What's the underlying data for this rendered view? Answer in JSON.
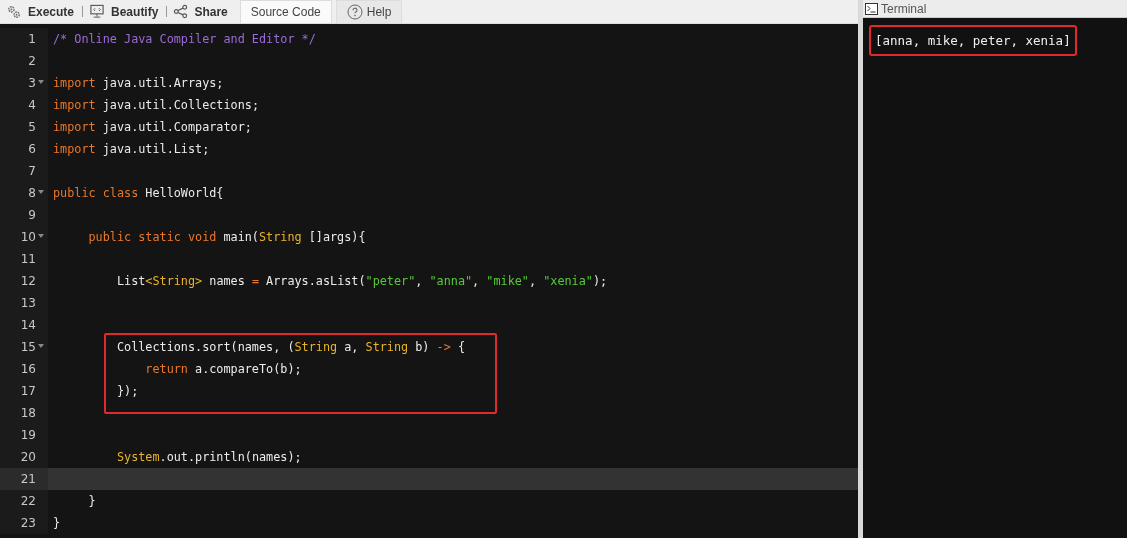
{
  "toolbar": [
    {
      "kind": "action",
      "label": "Execute"
    },
    {
      "kind": "action",
      "label": "Beautify"
    },
    {
      "kind": "action",
      "label": "Share"
    },
    {
      "kind": "tab",
      "label": "Source Code",
      "selected": true
    },
    {
      "kind": "tab",
      "label": "Help",
      "selected": false
    }
  ],
  "editor": {
    "lines": [
      {
        "number": "1",
        "tokens": [
          {
            "kind": "comment",
            "text": "/* Online Java Compiler and Editor */"
          }
        ]
      },
      {
        "number": "2"
      },
      {
        "number": "3",
        "foldable": true,
        "tokens": [
          {
            "kind": "keyword",
            "text": "import"
          },
          {
            "kind": "plain",
            "text": " java.util.Arrays;"
          }
        ]
      },
      {
        "number": "4",
        "tokens": [
          {
            "kind": "keyword",
            "text": "import"
          },
          {
            "kind": "plain",
            "text": " java.util.Collections;"
          }
        ]
      },
      {
        "number": "5",
        "tokens": [
          {
            "kind": "keyword",
            "text": "import"
          },
          {
            "kind": "plain",
            "text": " java.util.Comparator;"
          }
        ]
      },
      {
        "number": "6",
        "tokens": [
          {
            "kind": "keyword",
            "text": "import"
          },
          {
            "kind": "plain",
            "text": " java.util.List;"
          }
        ]
      },
      {
        "number": "7"
      },
      {
        "number": "8",
        "foldable": true,
        "tokens": [
          {
            "kind": "keyword",
            "text": "public class"
          },
          {
            "kind": "plain",
            "text": " HelloWorld{"
          }
        ]
      },
      {
        "number": "9"
      },
      {
        "number": "10",
        "foldable": true,
        "tokens": [
          {
            "kind": "keyword",
            "text": "     public static void"
          },
          {
            "kind": "plain",
            "text": " main("
          },
          {
            "kind": "type",
            "text": "String"
          },
          {
            "kind": "plain",
            "text": " []args){"
          }
        ]
      },
      {
        "number": "11"
      },
      {
        "number": "12",
        "tokens": [
          {
            "kind": "plain",
            "text": "         List"
          },
          {
            "kind": "type",
            "text": "<String>"
          },
          {
            "kind": "plain",
            "text": " names "
          },
          {
            "kind": "keyword",
            "text": "="
          },
          {
            "kind": "plain",
            "text": " Arrays.asList("
          },
          {
            "kind": "string",
            "text": "\"peter\""
          },
          {
            "kind": "plain",
            "text": ", "
          },
          {
            "kind": "string",
            "text": "\"anna\""
          },
          {
            "kind": "plain",
            "text": ", "
          },
          {
            "kind": "string",
            "text": "\"mike\""
          },
          {
            "kind": "plain",
            "text": ", "
          },
          {
            "kind": "string",
            "text": "\"xenia\""
          },
          {
            "kind": "plain",
            "text": ");"
          }
        ]
      },
      {
        "number": "13"
      },
      {
        "number": "14"
      },
      {
        "number": "15",
        "foldable": true,
        "boxed": true,
        "tokens": [
          {
            "kind": "plain",
            "text": "         Collections.sort(names, ("
          },
          {
            "kind": "type",
            "text": "String"
          },
          {
            "kind": "plain",
            "text": " a, "
          },
          {
            "kind": "type",
            "text": "String"
          },
          {
            "kind": "plain",
            "text": " b) "
          },
          {
            "kind": "keyword",
            "text": "->"
          },
          {
            "kind": "plain",
            "text": " {"
          }
        ]
      },
      {
        "number": "16",
        "boxed": true,
        "tokens": [
          {
            "kind": "keyword",
            "text": "             return"
          },
          {
            "kind": "plain",
            "text": " a.compareTo(b);"
          }
        ]
      },
      {
        "number": "17",
        "boxed": true,
        "tokens": [
          {
            "kind": "plain",
            "text": "         });"
          }
        ]
      },
      {
        "number": "18",
        "boxed": true
      },
      {
        "number": "19"
      },
      {
        "number": "20",
        "tokens": [
          {
            "kind": "type",
            "text": "         System"
          },
          {
            "kind": "plain",
            "text": ".out.println(names);"
          }
        ]
      },
      {
        "number": "21",
        "active": true
      },
      {
        "number": "22",
        "tokens": [
          {
            "kind": "plain",
            "text": "     }"
          }
        ]
      },
      {
        "number": "23",
        "tokens": [
          {
            "kind": "plain",
            "text": "}"
          }
        ]
      }
    ]
  },
  "terminal": {
    "title": "Terminal",
    "output": [
      {
        "text": "[anna, mike, peter, xenia]",
        "boxed": true
      }
    ]
  }
}
